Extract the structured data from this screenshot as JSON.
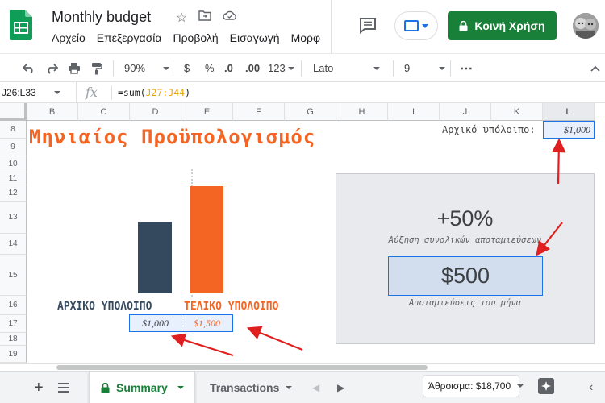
{
  "app": {
    "doc_title": "Monthly budget",
    "menu": [
      "Αρχείο",
      "Επεξεργασία",
      "Προβολή",
      "Εισαγωγή",
      "Μορφ"
    ],
    "share_label": "Κοινή Χρήση"
  },
  "toolbar": {
    "zoom": "90%",
    "currency": "$",
    "percent": "%",
    "dec_decrease": ".0",
    "dec_increase": ".00",
    "more_formats": "123",
    "font": "Lato",
    "font_size": "9",
    "more": "⋯"
  },
  "formula_bar": {
    "name_box": "J26:L33",
    "fx": "fx",
    "formula_prefix": "=sum(",
    "formula_ref": "J27:J44",
    "formula_suffix": ")"
  },
  "columns": [
    "B",
    "C",
    "D",
    "E",
    "F",
    "G",
    "H",
    "I",
    "J",
    "K",
    "L"
  ],
  "rows": [
    "8",
    "9",
    "10",
    "11",
    "12",
    "13",
    "14",
    "15",
    "16",
    "17",
    "18",
    "19"
  ],
  "sheet": {
    "title": "Μηνιαίος Προϋπολογισμός",
    "initial_balance_label": "Αρχικό υπόλοιπο:",
    "initial_balance_value": "$1,000",
    "start_label": "ΑΡΧΙΚΟ ΥΠΟΛΟΙΠΟ",
    "end_label": "ΤΕΛΙΚΟ ΥΠΟΛΟΙΠΟ",
    "start_value": "$1,000",
    "end_value": "$1,500",
    "increase_pct": "+50%",
    "increase_label": "Αύξηση συνολικών αποταμιεύσεων",
    "savings_value": "$500",
    "savings_label": "Αποταμιεύσεις του μήνα"
  },
  "chart_data": {
    "type": "bar",
    "categories": [
      "ΑΡΧΙΚΟ ΥΠΟΛΟΙΠΟ",
      "ΤΕΛΙΚΟ ΥΠΟΛΟΙΠΟ"
    ],
    "values": [
      1000,
      1500
    ],
    "colors": [
      "#35495e",
      "#f46524"
    ],
    "ylim": [
      0,
      1500
    ]
  },
  "bottom_bar": {
    "tabs": [
      "Summary",
      "Transactions"
    ],
    "sum_label": "Άθροισμα: $18,700"
  },
  "colors": {
    "accent_orange": "#f46524",
    "navy": "#35495e",
    "share_green": "#188038",
    "selection_blue": "#1a73e8"
  }
}
